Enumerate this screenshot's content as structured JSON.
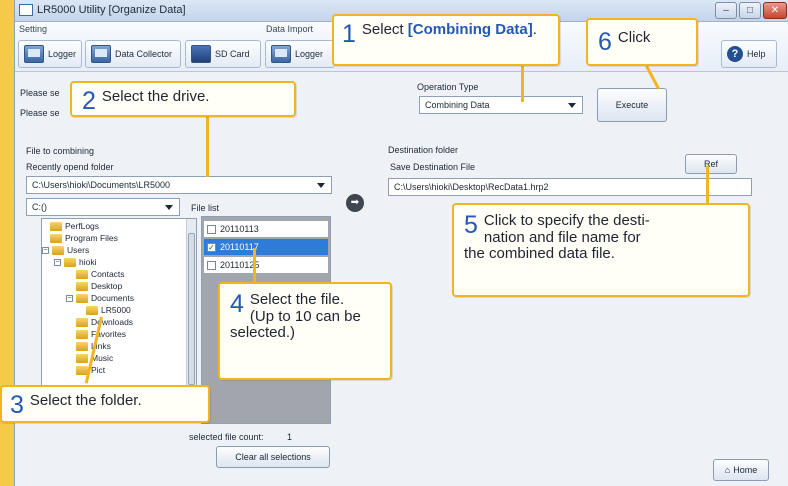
{
  "titlebar": {
    "title": "LR5000 Utility [Organize Data]",
    "min": "–",
    "max": "□",
    "close": "✕"
  },
  "toolbar": {
    "setting_group": "Setting",
    "data_import_group": "Data Import",
    "logger": "Logger",
    "data_collector": "Data Collector",
    "sd_card": "SD Card",
    "logger_import": "Logger",
    "help": "Help",
    "help_glyph": "?"
  },
  "main": {
    "please_select_1": "Please se",
    "please_select_2": "Please se",
    "operation_type_label": "Operation Type",
    "operation_type_value": "Combining Data",
    "execute": "Execute",
    "file_to_combining": "File to combining",
    "recently_opened": "Recently opend folder",
    "folder_path": "C:\\Users\\hioki\\Documents\\LR5000",
    "drive": "C:()",
    "file_list_label": "File list",
    "destination_folder": "Destination folder",
    "save_destination": "Save Destination File",
    "destination_path": "C:\\Users\\hioki\\Desktop\\RecData1.hrp2",
    "ref": "Ref",
    "selected_count_label": "selected file count:",
    "selected_count": "1",
    "clear_all": "Clear all selections",
    "home": "Home",
    "arrow_glyph": "➡"
  },
  "tree": {
    "items": [
      "PerfLogs",
      "Program Files",
      "Users",
      "hioki",
      "Contacts",
      "Desktop",
      "Documents",
      "LR5000",
      "Downloads",
      "Favorites",
      "Links",
      "Music",
      "Pict"
    ],
    "expanders": [
      "−",
      "−",
      "−"
    ]
  },
  "files": [
    {
      "name": "20110113",
      "checked": false,
      "mark": ""
    },
    {
      "name": "20110117",
      "checked": true,
      "mark": "✓"
    },
    {
      "name": "20110125",
      "checked": false,
      "mark": ""
    }
  ],
  "callouts": {
    "c1_num": "1",
    "c1_text": "Select ",
    "c1_hl": "[Combining Data]",
    "c1_tail": ".",
    "c2_num": "2",
    "c2_text": "Select the drive.",
    "c3_num": "3",
    "c3_text": "Select the folder.",
    "c4_num": "4",
    "c4_text": "Select the file.",
    "c4_sub1": "(Up to 10 can be",
    "c4_sub2": "selected.)",
    "c5_num": "5",
    "c5_text": "Click to specify the desti-",
    "c5_l2": "nation and file name for",
    "c5_l3": "the combined data file.",
    "c6_num": "6",
    "c6_text": "Click"
  }
}
